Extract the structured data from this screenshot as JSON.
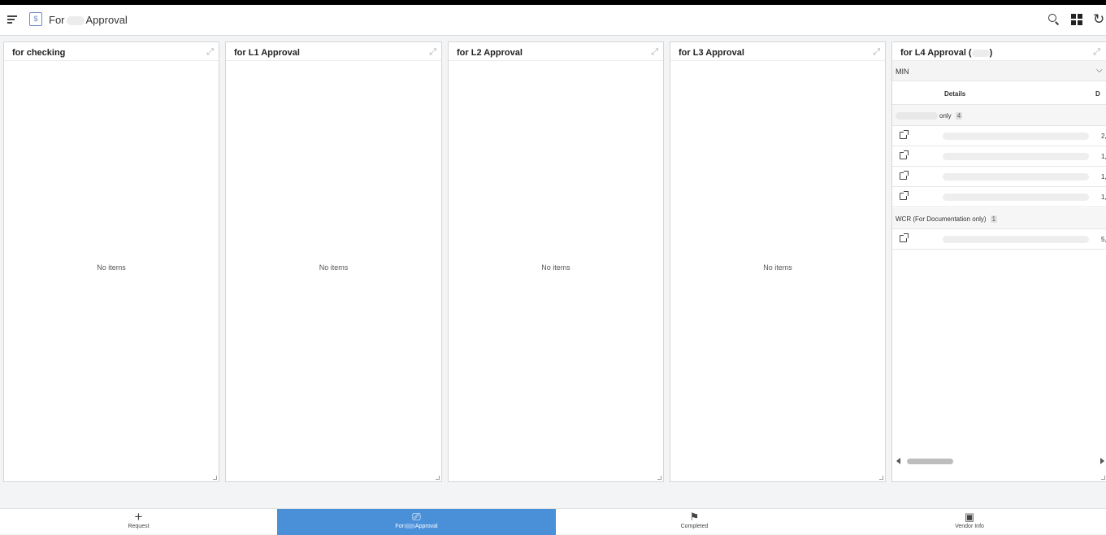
{
  "header": {
    "title_prefix": "For",
    "title_suffix": "Approval",
    "app_icon_glyph": "$",
    "icons": [
      "menu-icon",
      "search-icon",
      "grid-view-icon",
      "refresh-icon"
    ]
  },
  "panels": [
    {
      "title": "for checking",
      "empty_text": "No items"
    },
    {
      "title": "for L1 Approval",
      "empty_text": "No items"
    },
    {
      "title": "for L2 Approval",
      "empty_text": "No items"
    },
    {
      "title": "for L3 Approval",
      "empty_text": "No items"
    }
  ],
  "l4_panel": {
    "title_prefix": "for L4 Approval (",
    "title_suffix": ")",
    "dropdown_value": "MIN",
    "columns": [
      "Details",
      "D"
    ],
    "groups": [
      {
        "label": "only",
        "count": "4",
        "rows": [
          {
            "value": "2,"
          },
          {
            "value": "1,"
          },
          {
            "value": "1,"
          },
          {
            "value": "1,"
          }
        ]
      },
      {
        "label": "WCR (For Documentation only)",
        "count": "1",
        "rows": [
          {
            "value": "5,"
          }
        ]
      }
    ]
  },
  "bottom_nav": [
    {
      "label": "Request",
      "icon": "plus-icon",
      "glyph": "+"
    },
    {
      "label_prefix": "For",
      "label_suffix": "Approval",
      "icon": "approval-icon",
      "glyph": "⎚",
      "active": true
    },
    {
      "label": "Completed",
      "icon": "flag-icon",
      "glyph": "⚑"
    },
    {
      "label": "Vendor Info",
      "icon": "vendor-icon",
      "glyph": "▣"
    }
  ],
  "colors": {
    "accent": "#4a90d9",
    "app_icon": "#6a8bc4"
  }
}
